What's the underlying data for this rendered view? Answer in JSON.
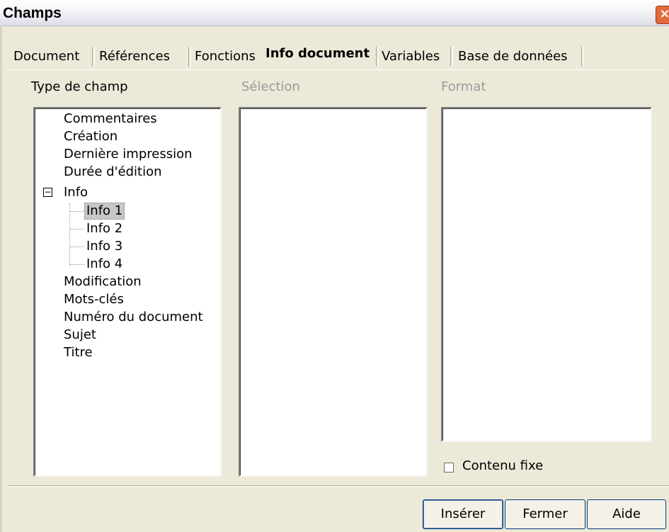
{
  "window": {
    "title": "Champs",
    "close_label": "×"
  },
  "tabs": [
    "Document",
    "Références",
    "Fonctions",
    "Info document",
    "Variables",
    "Base de données"
  ],
  "active_tab": "Info document",
  "columns": {
    "type_label": "Type de champ",
    "selection_label": "Sélection",
    "format_label": "Format"
  },
  "tree": {
    "items": [
      "Commentaires",
      "Création",
      "Dernière impression",
      "Durée d'édition",
      "Info"
    ],
    "info_toggle": "−",
    "info_children": [
      "Info 1",
      "Info 2",
      "Info 3",
      "Info 4"
    ],
    "items_after": [
      "Modification",
      "Mots-clés",
      "Numéro du document",
      "Sujet",
      "Titre"
    ],
    "selected": "Info 1"
  },
  "checkbox": {
    "label": "Contenu fixe",
    "checked": false
  },
  "buttons": {
    "insert": "Insérer",
    "close": "Fermer",
    "help": "Aide"
  }
}
